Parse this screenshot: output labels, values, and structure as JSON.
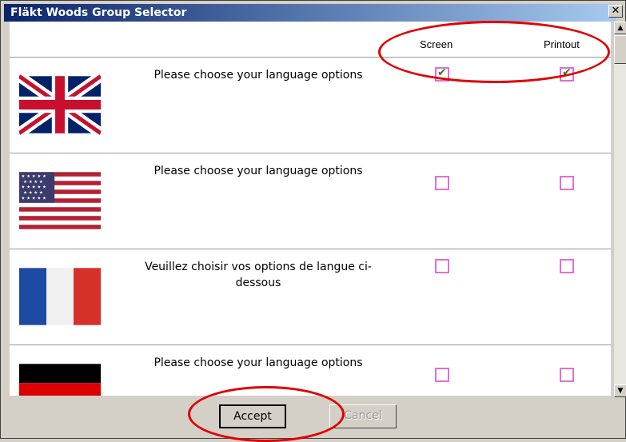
{
  "window": {
    "title": "Fläkt Woods Group Selector",
    "close_glyph": "✕"
  },
  "columns": {
    "screen": "Screen",
    "printout": "Printout"
  },
  "rows": [
    {
      "flag": "uk-flag",
      "text": "Please choose your language options",
      "screen_checked": true,
      "printout_checked": true
    },
    {
      "flag": "us-flag",
      "text": "Please choose your language options",
      "screen_checked": false,
      "printout_checked": false
    },
    {
      "flag": "france-flag",
      "text": "Veuillez choisir vos options de langue ci-dessous",
      "screen_checked": false,
      "printout_checked": false
    },
    {
      "flag": "germany-flag",
      "text": "Please choose your language options",
      "screen_checked": false,
      "printout_checked": false
    }
  ],
  "buttons": {
    "accept": "Accept",
    "cancel": "Cancel"
  },
  "highlight_color": "#e00000"
}
